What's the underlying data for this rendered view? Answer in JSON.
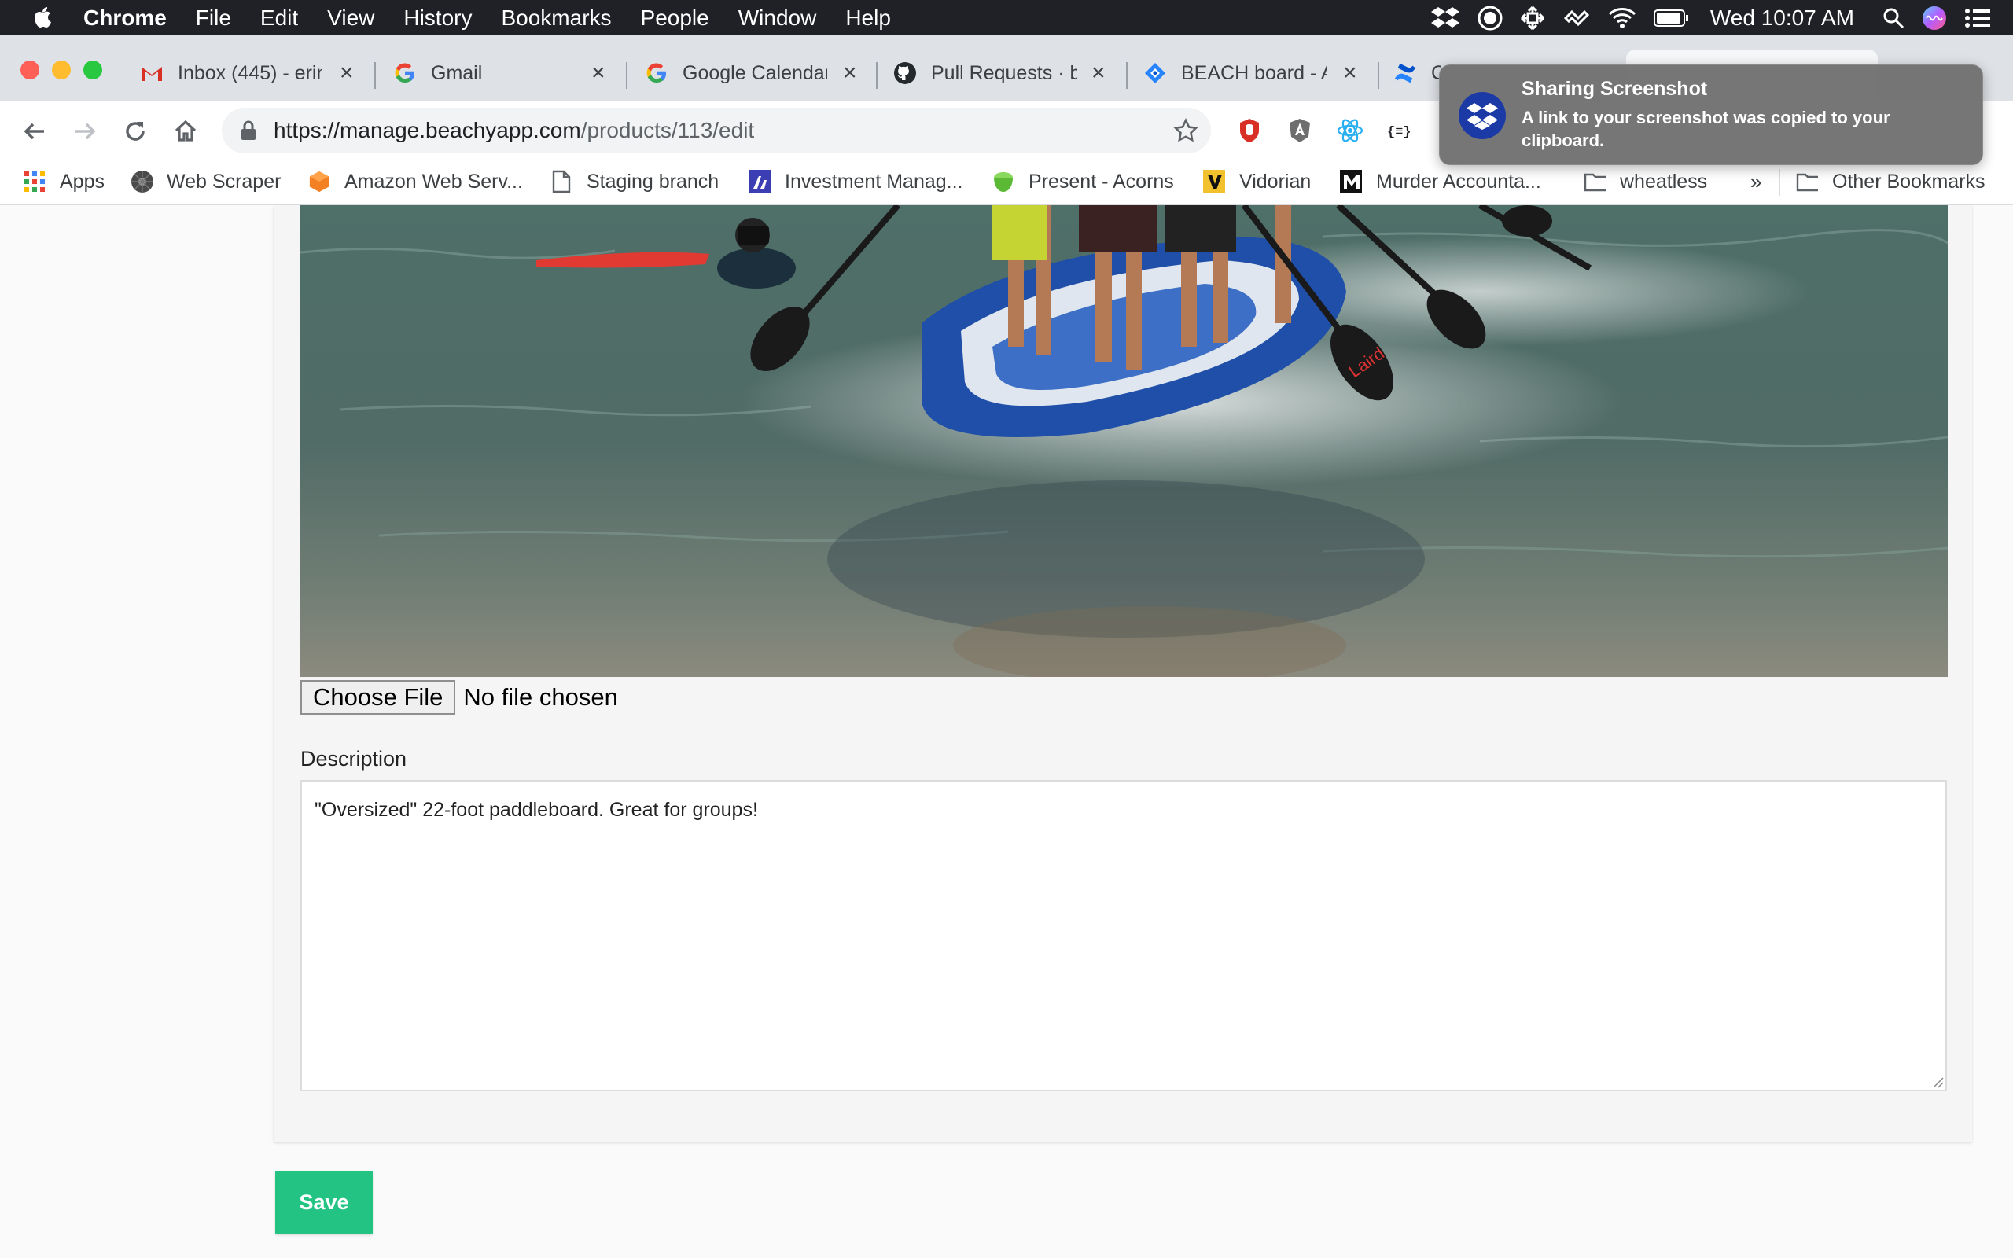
{
  "menubar": {
    "app_name": "Chrome",
    "items": [
      "File",
      "Edit",
      "View",
      "History",
      "Bookmarks",
      "People",
      "Window",
      "Help"
    ],
    "clock": "Wed 10:07 AM"
  },
  "tabs": [
    {
      "title": "Inbox (445) - erin",
      "icon": "gmail-icon"
    },
    {
      "title": "Gmail",
      "icon": "google-icon"
    },
    {
      "title": "Google Calendar",
      "icon": "google-icon"
    },
    {
      "title": "Pull Requests · b",
      "icon": "github-icon"
    },
    {
      "title": "BEACH board - A",
      "icon": "jira-icon"
    },
    {
      "title": "C",
      "icon": "confluence-icon"
    }
  ],
  "address": {
    "host": "https://manage.beachyapp.com",
    "path": "/products/113/edit"
  },
  "bookmarks": [
    {
      "label": "Apps",
      "icon": "apps-grid-icon"
    },
    {
      "label": "Web Scraper",
      "icon": "web-scraper-icon"
    },
    {
      "label": "Amazon Web Serv...",
      "icon": "aws-icon"
    },
    {
      "label": "Staging branch",
      "icon": "page-icon"
    },
    {
      "label": "Investment Manag...",
      "icon": "investment-icon"
    },
    {
      "label": "Present - Acorns",
      "icon": "acorns-icon"
    },
    {
      "label": "Vidorian",
      "icon": "vidorian-icon"
    },
    {
      "label": "Murder Accounta...",
      "icon": "m-icon"
    },
    {
      "label": "wheatless",
      "icon": "folder-icon"
    },
    {
      "label": "»",
      "icon": "chevron-double-icon"
    },
    {
      "label": "Other Bookmarks",
      "icon": "folder-icon"
    }
  ],
  "form": {
    "choose_file_label": "Choose File",
    "file_status": "No file chosen",
    "description_label": "Description",
    "description_value": "\"Oversized\" 22-foot paddleboard. Great for groups!",
    "save_label": "Save"
  },
  "photo": {
    "paddle_text": "Laird"
  },
  "notification": {
    "title": "Sharing Screenshot",
    "body": "A link to your screenshot was copied to your clipboard."
  },
  "colors": {
    "save_button": "#23c483",
    "menubar": "#1f2127",
    "tabstrip": "#dee1e6"
  }
}
